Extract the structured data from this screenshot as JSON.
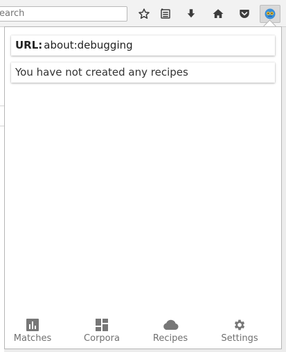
{
  "toolbar": {
    "search_placeholder": "earch",
    "icons": [
      "star-icon",
      "reader-list-icon",
      "download-arrow-icon",
      "home-icon",
      "pocket-icon",
      "extension-face-icon"
    ]
  },
  "popup": {
    "url_label": "URL:",
    "url_value": "about:debugging",
    "recipes_message": "You have not created any recipes"
  },
  "nav": {
    "items": [
      {
        "label": "Matches",
        "icon": "bar-chart-icon"
      },
      {
        "label": "Corpora",
        "icon": "dashboard-icon"
      },
      {
        "label": "Recipes",
        "icon": "cloud-icon"
      },
      {
        "label": "Settings",
        "icon": "gear-icon"
      }
    ]
  },
  "colors": {
    "nav_icon": "#777777",
    "toolbar_icon": "#3c3c3c",
    "extension_face_blue": "#3a8fd9",
    "extension_face_yellow": "#f2c230"
  }
}
